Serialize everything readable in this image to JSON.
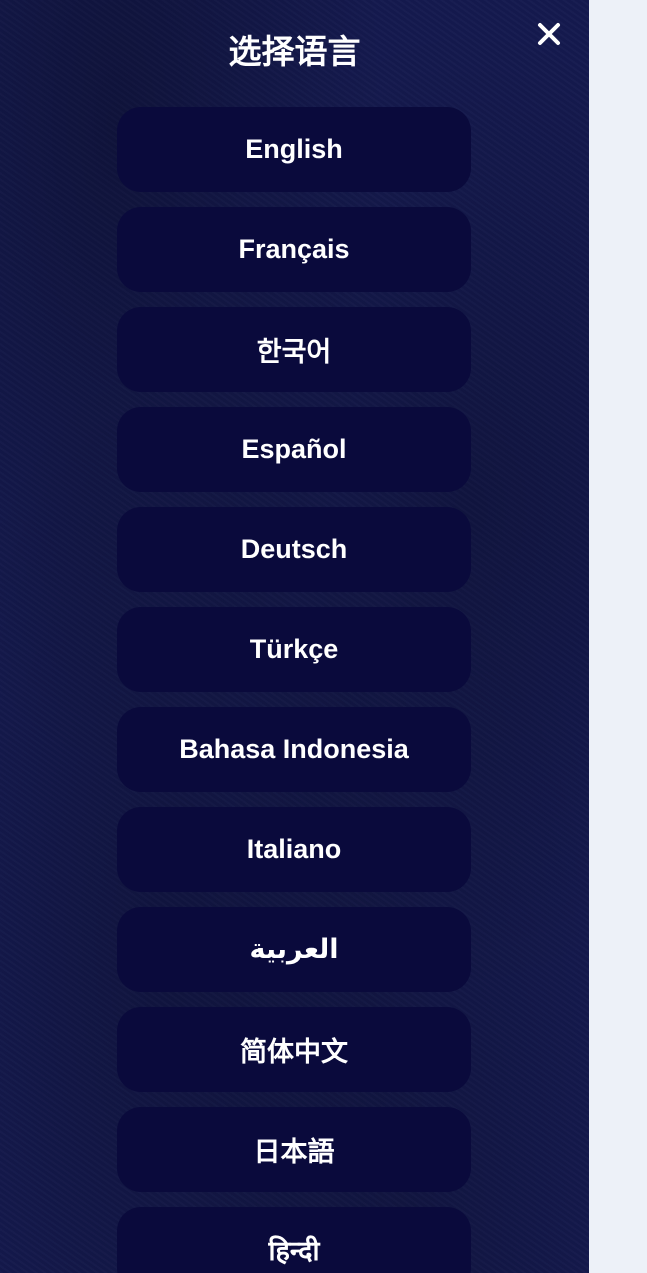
{
  "dialog": {
    "title": "选择语言",
    "close_icon": "close-icon"
  },
  "languages": [
    {
      "label": "English"
    },
    {
      "label": "Français"
    },
    {
      "label": "한국어"
    },
    {
      "label": "Español"
    },
    {
      "label": "Deutsch"
    },
    {
      "label": "Türkçe"
    },
    {
      "label": "Bahasa Indonesia"
    },
    {
      "label": "Italiano"
    },
    {
      "label": "العربية"
    },
    {
      "label": "简体中文"
    },
    {
      "label": "日本語"
    },
    {
      "label": "हिन्दी"
    }
  ],
  "colors": {
    "panel_bg": "#151a4f",
    "button_bg": "#0a0a3c",
    "page_bg": "#edf1f8",
    "text": "#ffffff"
  }
}
